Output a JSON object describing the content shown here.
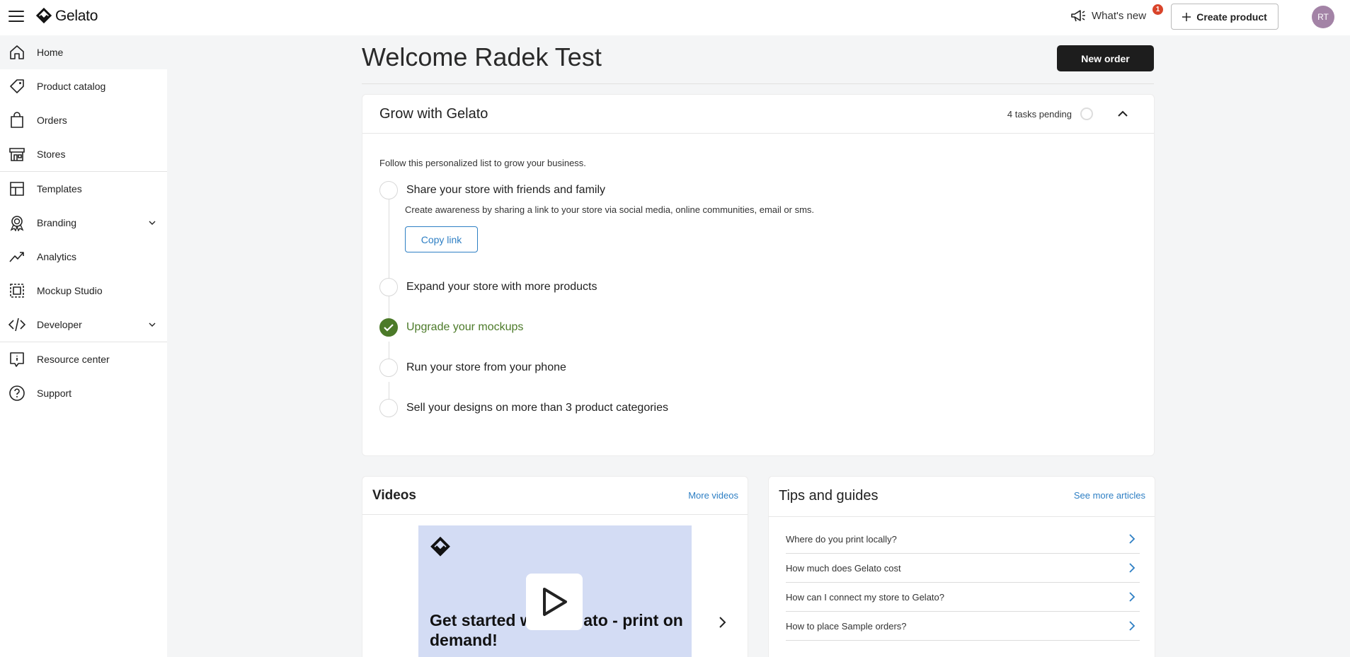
{
  "topbar": {
    "logo_text": "Gelato",
    "whats_new_label": "What's new",
    "notification_count": "1",
    "create_product_label": "Create product",
    "avatar_initials": "RT"
  },
  "sidebar": {
    "items": [
      {
        "label": "Home",
        "icon": "home-icon",
        "active": true
      },
      {
        "label": "Product catalog",
        "icon": "tag-icon"
      },
      {
        "label": "Orders",
        "icon": "shopping-bag-icon"
      },
      {
        "label": "Stores",
        "icon": "store-icon"
      },
      {
        "label": "Templates",
        "icon": "template-icon"
      },
      {
        "label": "Branding",
        "icon": "badge-icon",
        "expandable": true
      },
      {
        "label": "Analytics",
        "icon": "trend-icon"
      },
      {
        "label": "Mockup Studio",
        "icon": "mockup-icon"
      },
      {
        "label": "Developer",
        "icon": "code-icon",
        "expandable": true
      },
      {
        "label": "Resource center",
        "icon": "info-icon"
      },
      {
        "label": "Support",
        "icon": "help-icon"
      }
    ]
  },
  "main": {
    "welcome": "Welcome Radek Test",
    "new_order_label": "New order",
    "grow": {
      "title": "Grow with Gelato",
      "tasks_pending": "4 tasks pending",
      "intro": "Follow this personalized list to grow your business.",
      "tasks": [
        {
          "label": "Share your store with friends and family",
          "done": false
        },
        {
          "label": "Expand your store with more products",
          "done": false
        },
        {
          "label": "Upgrade your mockups",
          "done": true
        },
        {
          "label": "Run your store from your phone",
          "done": false
        },
        {
          "label": "Sell your designs on more than 3 product categories",
          "done": false
        }
      ],
      "task_description": "Create awareness by sharing a link to your store via social media, online communities, email or sms.",
      "copy_link_label": "Copy link"
    },
    "videos": {
      "title": "Videos",
      "more_label": "More videos",
      "video_title": "Get started with Gelato - print on demand!"
    },
    "tips": {
      "title": "Tips and guides",
      "more_label": "See more articles",
      "items": [
        "Where do you print locally?",
        "How much does Gelato cost",
        "How can I connect my store to Gelato?",
        "How to place Sample orders?"
      ]
    }
  },
  "colors": {
    "accent_link": "#2e7fc4",
    "done_green": "#4c7a29",
    "primary_button": "#1d1d1d",
    "notification": "#d9442a",
    "avatar": "#a383a6"
  }
}
